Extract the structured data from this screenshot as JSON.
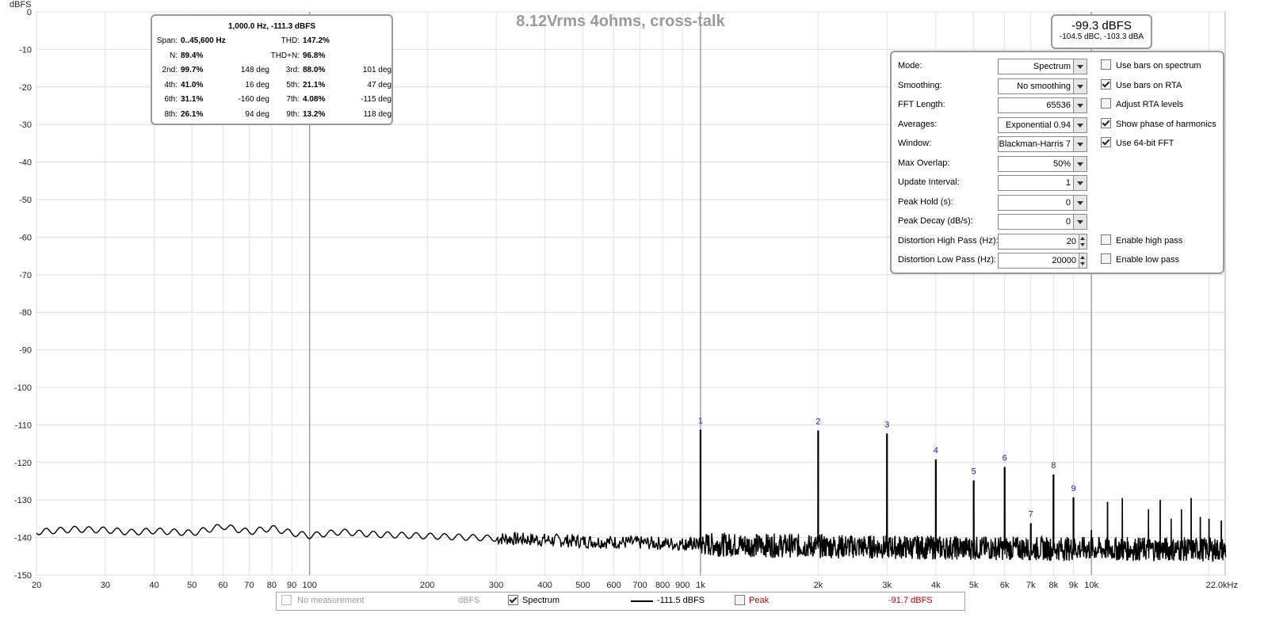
{
  "chart_data": {
    "type": "line",
    "title": "8.12Vrms 4ohms, cross-talk",
    "ylabel": "dBFS",
    "xlabel": "",
    "x_scale": "log",
    "xlim": [
      20,
      22000
    ],
    "ylim": [
      -150,
      0
    ],
    "grid": true,
    "y_ticks": [
      0,
      -10,
      -20,
      -30,
      -40,
      -50,
      -60,
      -70,
      -80,
      -90,
      -100,
      -110,
      -120,
      -130,
      -140,
      -150
    ],
    "x_ticks": [
      {
        "v": 20,
        "label": "20"
      },
      {
        "v": 30,
        "label": "30"
      },
      {
        "v": 40,
        "label": "40"
      },
      {
        "v": 50,
        "label": "50"
      },
      {
        "v": 60,
        "label": "60"
      },
      {
        "v": 70,
        "label": "70"
      },
      {
        "v": 80,
        "label": "80"
      },
      {
        "v": 90,
        "label": "90"
      },
      {
        "v": 100,
        "label": "100"
      },
      {
        "v": 200,
        "label": "200"
      },
      {
        "v": 300,
        "label": "300"
      },
      {
        "v": 400,
        "label": "400"
      },
      {
        "v": 500,
        "label": "500"
      },
      {
        "v": 600,
        "label": "600"
      },
      {
        "v": 700,
        "label": "700"
      },
      {
        "v": 800,
        "label": "800"
      },
      {
        "v": 900,
        "label": "900"
      },
      {
        "v": 1000,
        "label": "1k"
      },
      {
        "v": 2000,
        "label": "2k"
      },
      {
        "v": 3000,
        "label": "3k"
      },
      {
        "v": 4000,
        "label": "4k"
      },
      {
        "v": 5000,
        "label": "5k"
      },
      {
        "v": 6000,
        "label": "6k"
      },
      {
        "v": 7000,
        "label": "7k"
      },
      {
        "v": 8000,
        "label": "8k"
      },
      {
        "v": 9000,
        "label": "9k"
      },
      {
        "v": 10000,
        "label": "10k"
      },
      {
        "v": 22000,
        "label": "22.0kHz"
      }
    ],
    "series": [
      {
        "name": "Spectrum",
        "color": "#000000",
        "noise_floor": [
          [
            20,
            -138.5
          ],
          [
            25,
            -137.8
          ],
          [
            30,
            -138.0
          ],
          [
            35,
            -138.6
          ],
          [
            40,
            -138.2
          ],
          [
            50,
            -138.8
          ],
          [
            60,
            -137.0
          ],
          [
            70,
            -138.5
          ],
          [
            80,
            -137.5
          ],
          [
            90,
            -138.8
          ],
          [
            100,
            -139.5
          ],
          [
            120,
            -138.5
          ],
          [
            150,
            -139.2
          ],
          [
            200,
            -139.6
          ],
          [
            300,
            -140.2
          ],
          [
            500,
            -141.0
          ],
          [
            1000,
            -141.8
          ],
          [
            2000,
            -142.3
          ],
          [
            5000,
            -142.8
          ],
          [
            10000,
            -143.0
          ],
          [
            22000,
            -143.2
          ]
        ],
        "harmonics": [
          {
            "n": 1,
            "freq": 1000,
            "level": -111.3
          },
          {
            "n": 2,
            "freq": 2000,
            "level": -111.5
          },
          {
            "n": 3,
            "freq": 3000,
            "level": -112.3
          },
          {
            "n": 4,
            "freq": 4000,
            "level": -119.2
          },
          {
            "n": 5,
            "freq": 5000,
            "level": -124.8
          },
          {
            "n": 6,
            "freq": 6000,
            "level": -121.2
          },
          {
            "n": 7,
            "freq": 7000,
            "level": -136.2
          },
          {
            "n": 8,
            "freq": 8000,
            "level": -123.2
          },
          {
            "n": 9,
            "freq": 9000,
            "level": -129.3
          }
        ],
        "extra_spurs": [
          {
            "freq": 10000,
            "level": -138.0
          },
          {
            "freq": 11000,
            "level": -130.5
          },
          {
            "freq": 12000,
            "level": -129.5
          },
          {
            "freq": 14000,
            "level": -132.5
          },
          {
            "freq": 15000,
            "level": -130.0
          },
          {
            "freq": 16000,
            "level": -135.0
          },
          {
            "freq": 17000,
            "level": -132.5
          },
          {
            "freq": 18000,
            "level": -129.5
          },
          {
            "freq": 19000,
            "level": -134.5
          },
          {
            "freq": 20000,
            "level": -135.0
          },
          {
            "freq": 21500,
            "level": -135.5
          }
        ]
      }
    ]
  },
  "info_panel": {
    "header": "1,000.0 Hz, -111.3 dBFS",
    "rows": [
      [
        {
          "k": "Span:",
          "v": "0..45,600 Hz"
        },
        {
          "k": "THD:",
          "v": "147.2%"
        }
      ],
      [
        {
          "k": "N:",
          "v": "89.4%"
        },
        {
          "k": "THD+N:",
          "v": "96.8%"
        }
      ],
      [
        {
          "k": "2nd:",
          "v": "99.7%",
          "p": "148 deg"
        },
        {
          "k": "3rd:",
          "v": "88.0%",
          "p": "101 deg"
        }
      ],
      [
        {
          "k": "4th:",
          "v": "41.0%",
          "p": "16 deg"
        },
        {
          "k": "5th:",
          "v": "21.1%",
          "p": "47 deg"
        }
      ],
      [
        {
          "k": "6th:",
          "v": "31.1%",
          "p": "-160 deg"
        },
        {
          "k": "7th:",
          "v": "4.08%",
          "p": "-115 deg"
        }
      ],
      [
        {
          "k": "8th:",
          "v": "26.1%",
          "p": "94 deg"
        },
        {
          "k": "9th:",
          "v": "13.2%",
          "p": "118 deg"
        }
      ]
    ]
  },
  "level_panel": {
    "main": "-99.3 dBFS",
    "sub": "-104.5 dBC, -103.3 dBA"
  },
  "settings": {
    "rows": [
      {
        "label": "Mode:",
        "value": "Spectrum",
        "kind": "select"
      },
      {
        "label": "Smoothing:",
        "value": "No  smoothing",
        "kind": "select"
      },
      {
        "label": "FFT Length:",
        "value": "65536",
        "kind": "select"
      },
      {
        "label": "Averages:",
        "value": "Exponential 0.94",
        "kind": "select"
      },
      {
        "label": "Window:",
        "value": "Blackman-Harris 7",
        "kind": "select"
      },
      {
        "label": "Max Overlap:",
        "value": "50%",
        "kind": "select"
      },
      {
        "label": "Update Interval:",
        "value": "1",
        "kind": "select"
      },
      {
        "label": "Peak Hold (s):",
        "value": "0",
        "kind": "select"
      },
      {
        "label": "Peak Decay (dB/s):",
        "value": "0",
        "kind": "select"
      },
      {
        "label": "Distortion High Pass (Hz):",
        "value": "20",
        "kind": "spin"
      },
      {
        "label": "Distortion Low Pass (Hz):",
        "value": "20000",
        "kind": "spin"
      }
    ],
    "checks": [
      {
        "label": "Use bars on spectrum",
        "checked": false,
        "row": 0
      },
      {
        "label": "Use bars on RTA",
        "checked": true,
        "row": 1
      },
      {
        "label": "Adjust RTA levels",
        "checked": false,
        "row": 2
      },
      {
        "label": "Show phase of harmonics",
        "checked": true,
        "row": 3
      },
      {
        "label": "Use 64-bit FFT",
        "checked": true,
        "row": 4
      },
      {
        "label": "Enable high pass",
        "checked": false,
        "row": 9
      },
      {
        "label": "Enable low pass",
        "checked": false,
        "row": 10
      }
    ]
  },
  "legend": {
    "no_measurement": "No measurement",
    "unit": "dBFS",
    "spectrum_label": "Spectrum",
    "spectrum_checked": true,
    "spectrum_value": "-111.5 dBFS",
    "peak_label": "Peak",
    "peak_checked": false,
    "peak_value": "-91.7 dBFS",
    "peak_color": "#c00000"
  }
}
